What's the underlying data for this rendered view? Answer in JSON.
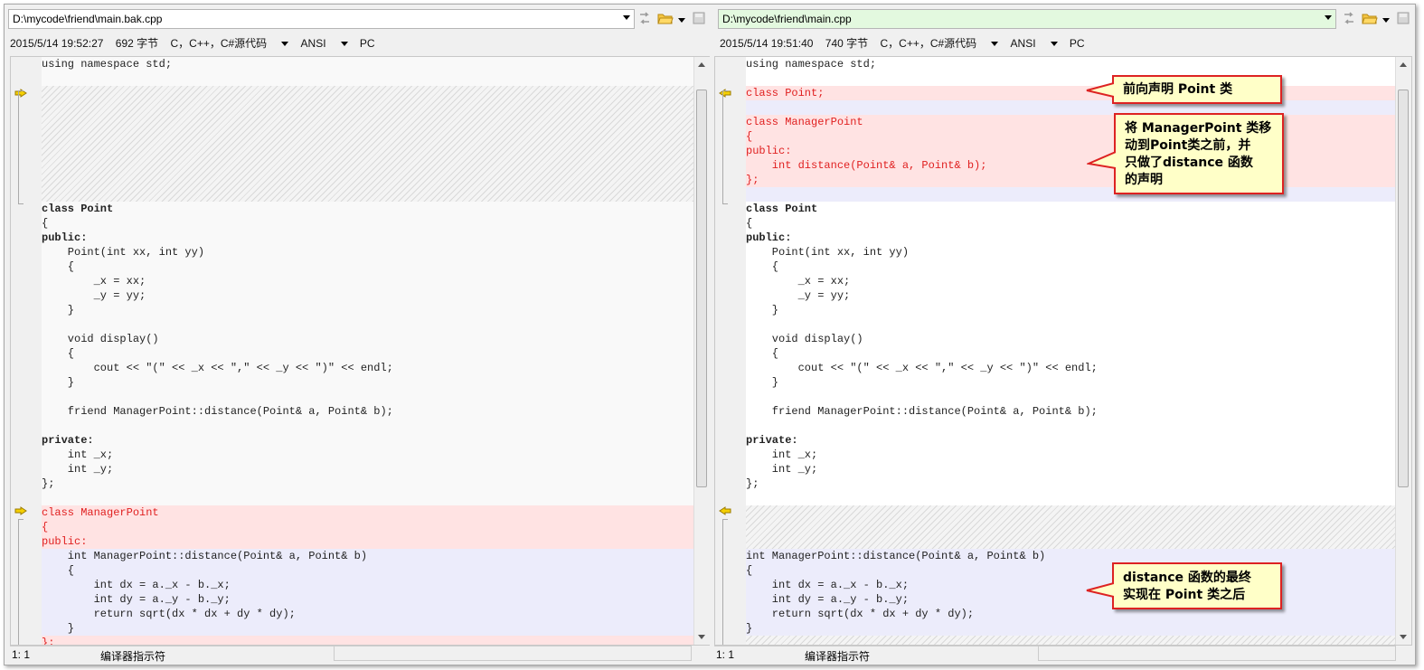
{
  "left": {
    "path": "D:\\mycode\\friend\\main.bak.cpp",
    "date": "2015/5/14 19:52:27",
    "size": "692 字节",
    "syntax": "C，C++，C#源代码",
    "encoding": "ANSI",
    "lineend": "PC",
    "status_pos": "1: 1",
    "status_mode": "编译器指示符"
  },
  "right": {
    "path": "D:\\mycode\\friend\\main.cpp",
    "date": "2015/5/14 19:51:40",
    "size": "740 字节",
    "syntax": "C，C++，C#源代码",
    "encoding": "ANSI",
    "lineend": "PC",
    "status_pos": "1: 1",
    "status_mode": "编译器指示符"
  },
  "left_code": [
    "using namespace std;",
    "class Point",
    "{",
    "public:",
    "    Point(int xx, int yy)",
    "    {",
    "        _x = xx;",
    "        _y = yy;",
    "    }",
    "    void display()",
    "    {",
    "        cout << \"(\" << _x << \",\" << _y << \")\" << endl;",
    "    }",
    "    friend ManagerPoint::distance(Point& a, Point& b);",
    "private:",
    "    int _x;",
    "    int _y;",
    "};",
    "class ManagerPoint",
    "{",
    "public:",
    "    int ManagerPoint::distance(Point& a, Point& b)",
    "    {",
    "        int dx = a._x - b._x;",
    "        int dy = a._y - b._y;",
    "        return sqrt(dx * dx + dy * dy);",
    "    }",
    "};"
  ],
  "right_code": [
    "using namespace std;",
    "class Point;",
    "class ManagerPoint",
    "{",
    "public:",
    "    int distance(Point& a, Point& b);",
    "};",
    "class Point",
    "{",
    "public:",
    "    Point(int xx, int yy)",
    "    {",
    "        _x = xx;",
    "        _y = yy;",
    "    }",
    "    void display()",
    "    {",
    "        cout << \"(\" << _x << \",\" << _y << \")\" << endl;",
    "    }",
    "    friend ManagerPoint::distance(Point& a, Point& b);",
    "private:",
    "    int _x;",
    "    int _y;",
    "};",
    "int ManagerPoint::distance(Point& a, Point& b)",
    "{",
    "    int dx = a._x - b._x;",
    "    int dy = a._y - b._y;",
    "    return sqrt(dx * dx + dy * dy);",
    "}"
  ],
  "callouts": {
    "c1": "前向声明 Point 类",
    "c2_l1": "将 ManagerPoint 类移",
    "c2_l2": "动到Point类之前，并",
    "c2_l3": "只做了distance 函数",
    "c2_l4": "的声明",
    "c3_l1": "distance 函数的最终",
    "c3_l2": "实现在 Point 类之后"
  },
  "colors": {
    "removed_bg": "#ffe3e3",
    "changed_bg": "#ececfb",
    "removed_text": "#e02020",
    "callout_border": "#dd2222",
    "callout_bg": "#ffffc8"
  }
}
